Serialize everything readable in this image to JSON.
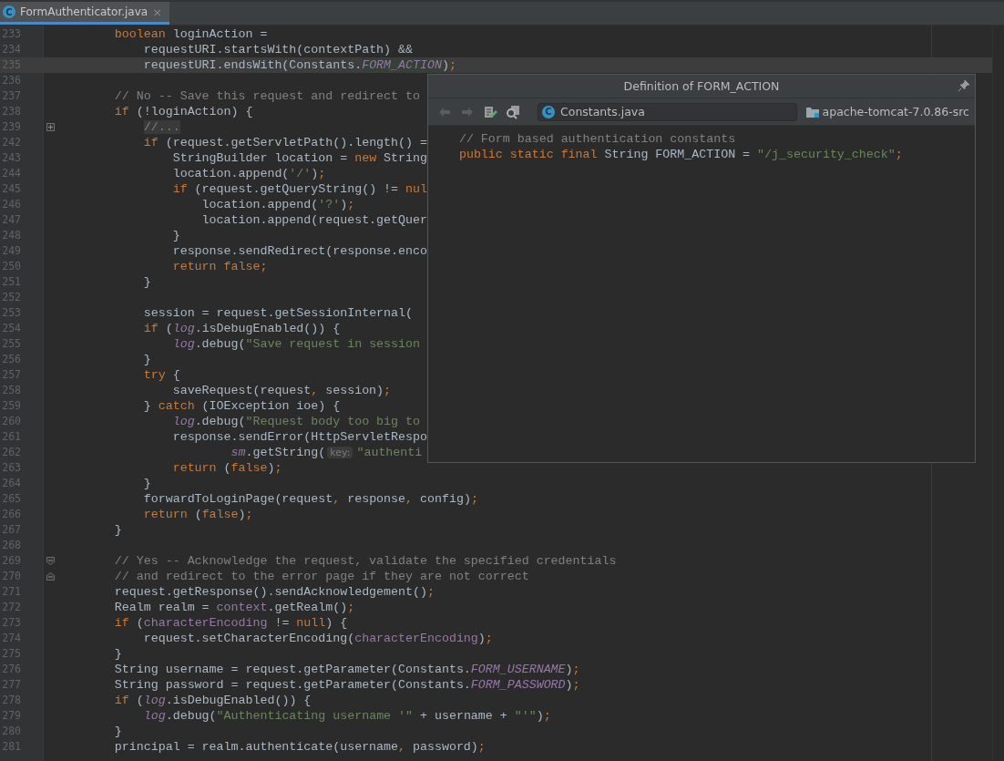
{
  "tabs": [
    {
      "label": "FormAuthenticator.java",
      "icon": "C",
      "selected": true,
      "close": "×"
    }
  ],
  "editor": {
    "lines": [
      {
        "number": "233",
        "kind": "code",
        "current": false,
        "tokens": [
          {
            "text": "        boolean",
            "kind": "kw"
          },
          {
            "text": " loginAction =",
            "kind": "plain"
          }
        ]
      },
      {
        "number": "234",
        "kind": "code",
        "current": false,
        "tokens": [
          {
            "text": "            requestURI.startsWith(contextPath) &&",
            "kind": "plain"
          }
        ]
      },
      {
        "number": "235",
        "kind": "code",
        "current": true,
        "tokens": [
          {
            "text": "            requestURI.endsWith(Constants.",
            "kind": "plain"
          },
          {
            "text": "FORM_ACTION",
            "kind": "match"
          },
          {
            "text": ")",
            "kind": "plain"
          },
          {
            "text": ";",
            "kind": "punct"
          }
        ]
      },
      {
        "number": "236",
        "kind": "code",
        "current": false
      },
      {
        "number": "237",
        "kind": "code",
        "current": false,
        "tokens": [
          {
            "text": "        // No -- Save this request and redirect to",
            "kind": "com"
          }
        ]
      },
      {
        "number": "238",
        "kind": "code",
        "current": false,
        "tokens": [
          {
            "text": "        if",
            "kind": "kw"
          },
          {
            "text": " (!loginAction) {",
            "kind": "plain"
          }
        ]
      },
      {
        "number": "239",
        "kind": "foldexpand",
        "current": false,
        "tokens": [
          {
            "text": "            //...",
            "kind": "fold"
          }
        ]
      },
      {
        "number": "242",
        "kind": "code",
        "current": false,
        "tokens": [
          {
            "text": "            if",
            "kind": "kw"
          },
          {
            "text": " (request.getServletPath().length() =",
            "kind": "plain"
          }
        ]
      },
      {
        "number": "243",
        "kind": "code",
        "current": false,
        "tokens": [
          {
            "text": "                StringBuilder location = ",
            "kind": "plain"
          },
          {
            "text": "new",
            "kind": "kw"
          },
          {
            "text": " String",
            "kind": "plain"
          }
        ]
      },
      {
        "number": "244",
        "kind": "code",
        "current": false,
        "tokens": [
          {
            "text": "                location.append(",
            "kind": "plain"
          },
          {
            "text": "'/'",
            "kind": "str"
          },
          {
            "text": ")",
            "kind": "plain"
          },
          {
            "text": ";",
            "kind": "punct"
          }
        ]
      },
      {
        "number": "245",
        "kind": "code",
        "current": false,
        "tokens": [
          {
            "text": "                if",
            "kind": "kw"
          },
          {
            "text": " (request.getQueryString() != ",
            "kind": "plain"
          },
          {
            "text": "nul",
            "kind": "kw"
          }
        ]
      },
      {
        "number": "246",
        "kind": "code",
        "current": false,
        "tokens": [
          {
            "text": "                    location.append(",
            "kind": "plain"
          },
          {
            "text": "'?'",
            "kind": "str"
          },
          {
            "text": ")",
            "kind": "plain"
          },
          {
            "text": ";",
            "kind": "punct"
          }
        ]
      },
      {
        "number": "247",
        "kind": "code",
        "current": false,
        "tokens": [
          {
            "text": "                    location.append(request.getQuer",
            "kind": "plain"
          }
        ]
      },
      {
        "number": "248",
        "kind": "code",
        "current": false,
        "tokens": [
          {
            "text": "                }",
            "kind": "plain"
          }
        ]
      },
      {
        "number": "249",
        "kind": "code",
        "current": false,
        "tokens": [
          {
            "text": "                response.sendRedirect(response.enco",
            "kind": "plain"
          }
        ]
      },
      {
        "number": "250",
        "kind": "code",
        "current": false,
        "tokens": [
          {
            "text": "                return false",
            "kind": "kw"
          },
          {
            "text": ";",
            "kind": "punct"
          }
        ]
      },
      {
        "number": "251",
        "kind": "code",
        "current": false,
        "tokens": [
          {
            "text": "            }",
            "kind": "plain"
          }
        ]
      },
      {
        "number": "252",
        "kind": "code",
        "current": false
      },
      {
        "number": "253",
        "kind": "code",
        "current": false,
        "tokens": [
          {
            "text": "            session = request.getSessionInternal(",
            "kind": "plain"
          }
        ]
      },
      {
        "number": "254",
        "kind": "code",
        "current": false,
        "tokens": [
          {
            "text": "            if",
            "kind": "kw"
          },
          {
            "text": " (",
            "kind": "plain"
          },
          {
            "text": "log",
            "kind": "ifield"
          },
          {
            "text": ".isDebugEnabled()) {",
            "kind": "plain"
          }
        ]
      },
      {
        "number": "255",
        "kind": "code",
        "current": false,
        "tokens": [
          {
            "text": "                log",
            "kind": "ifield"
          },
          {
            "text": ".debug(",
            "kind": "plain"
          },
          {
            "text": "\"Save request in session",
            "kind": "str"
          }
        ]
      },
      {
        "number": "256",
        "kind": "code",
        "current": false,
        "tokens": [
          {
            "text": "            }",
            "kind": "plain"
          }
        ]
      },
      {
        "number": "257",
        "kind": "code",
        "current": false,
        "tokens": [
          {
            "text": "            try",
            "kind": "kw"
          },
          {
            "text": " {",
            "kind": "plain"
          }
        ]
      },
      {
        "number": "258",
        "kind": "code",
        "current": false,
        "tokens": [
          {
            "text": "                saveRequest(request",
            "kind": "plain"
          },
          {
            "text": ",",
            "kind": "punct"
          },
          {
            "text": " session)",
            "kind": "plain"
          },
          {
            "text": ";",
            "kind": "punct"
          }
        ]
      },
      {
        "number": "259",
        "kind": "code",
        "current": false,
        "tokens": [
          {
            "text": "            } ",
            "kind": "plain"
          },
          {
            "text": "catch",
            "kind": "kw"
          },
          {
            "text": " (IOException ioe) {",
            "kind": "plain"
          }
        ]
      },
      {
        "number": "260",
        "kind": "code",
        "current": false,
        "tokens": [
          {
            "text": "                log",
            "kind": "ifield"
          },
          {
            "text": ".debug(",
            "kind": "plain"
          },
          {
            "text": "\"Request body too big to",
            "kind": "str"
          }
        ]
      },
      {
        "number": "261",
        "kind": "code",
        "current": false,
        "tokens": [
          {
            "text": "                response.sendError(HttpServletRespo",
            "kind": "plain"
          }
        ]
      },
      {
        "number": "262",
        "kind": "code",
        "current": false,
        "tokens": [
          {
            "text": "                        sm",
            "kind": "ifield"
          },
          {
            "text": ".getString(",
            "kind": "plain"
          },
          {
            "text": "key:",
            "kind": "hint"
          },
          {
            "text": "\"authenti",
            "kind": "str"
          }
        ]
      },
      {
        "number": "263",
        "kind": "code",
        "current": false,
        "tokens": [
          {
            "text": "                return",
            "kind": "kw"
          },
          {
            "text": " (",
            "kind": "plain"
          },
          {
            "text": "false",
            "kind": "kw"
          },
          {
            "text": ")",
            "kind": "plain"
          },
          {
            "text": ";",
            "kind": "punct"
          }
        ]
      },
      {
        "number": "264",
        "kind": "code",
        "current": false,
        "tokens": [
          {
            "text": "            }",
            "kind": "plain"
          }
        ]
      },
      {
        "number": "265",
        "kind": "code",
        "current": false,
        "tokens": [
          {
            "text": "            forwardToLoginPage(request",
            "kind": "plain"
          },
          {
            "text": ",",
            "kind": "punct"
          },
          {
            "text": " response",
            "kind": "plain"
          },
          {
            "text": ",",
            "kind": "punct"
          },
          {
            "text": " config)",
            "kind": "plain"
          },
          {
            "text": ";",
            "kind": "punct"
          }
        ]
      },
      {
        "number": "266",
        "kind": "code",
        "current": false,
        "tokens": [
          {
            "text": "            return",
            "kind": "kw"
          },
          {
            "text": " (",
            "kind": "plain"
          },
          {
            "text": "false",
            "kind": "kw"
          },
          {
            "text": ")",
            "kind": "plain"
          },
          {
            "text": ";",
            "kind": "punct"
          }
        ]
      },
      {
        "number": "267",
        "kind": "code",
        "current": false,
        "tokens": [
          {
            "text": "        }",
            "kind": "plain"
          }
        ]
      },
      {
        "number": "268",
        "kind": "code",
        "current": false
      },
      {
        "number": "269",
        "kind": "foldstart",
        "current": false,
        "tokens": [
          {
            "text": "        // Yes -- Acknowledge the request, validate the specified credentials",
            "kind": "com"
          }
        ]
      },
      {
        "number": "270",
        "kind": "foldend",
        "current": false,
        "tokens": [
          {
            "text": "        // and redirect to the error page if they are not correct",
            "kind": "com"
          }
        ]
      },
      {
        "number": "271",
        "kind": "code",
        "current": false,
        "tokens": [
          {
            "text": "        request.getResponse().sendAcknowledgement()",
            "kind": "plain"
          },
          {
            "text": ";",
            "kind": "punct"
          }
        ]
      },
      {
        "number": "272",
        "kind": "code",
        "current": false,
        "tokens": [
          {
            "text": "        Realm realm = ",
            "kind": "plain"
          },
          {
            "text": "context",
            "kind": "field"
          },
          {
            "text": ".getRealm()",
            "kind": "plain"
          },
          {
            "text": ";",
            "kind": "punct"
          }
        ]
      },
      {
        "number": "273",
        "kind": "code",
        "current": false,
        "tokens": [
          {
            "text": "        if",
            "kind": "kw"
          },
          {
            "text": " (",
            "kind": "plain"
          },
          {
            "text": "characterEncoding",
            "kind": "field"
          },
          {
            "text": " != ",
            "kind": "plain"
          },
          {
            "text": "null",
            "kind": "kw"
          },
          {
            "text": ") {",
            "kind": "plain"
          }
        ]
      },
      {
        "number": "274",
        "kind": "code",
        "current": false,
        "tokens": [
          {
            "text": "            request.setCharacterEncoding(",
            "kind": "plain"
          },
          {
            "text": "characterEncoding",
            "kind": "field"
          },
          {
            "text": ")",
            "kind": "plain"
          },
          {
            "text": ";",
            "kind": "punct"
          }
        ]
      },
      {
        "number": "275",
        "kind": "code",
        "current": false,
        "tokens": [
          {
            "text": "        }",
            "kind": "plain"
          }
        ]
      },
      {
        "number": "276",
        "kind": "code",
        "current": false,
        "tokens": [
          {
            "text": "        String username = request.getParameter(Constants.",
            "kind": "plain"
          },
          {
            "text": "FORM_USERNAME",
            "kind": "ifield"
          },
          {
            "text": ")",
            "kind": "plain"
          },
          {
            "text": ";",
            "kind": "punct"
          }
        ]
      },
      {
        "number": "277",
        "kind": "code",
        "current": false,
        "tokens": [
          {
            "text": "        String password = request.getParameter(Constants.",
            "kind": "plain"
          },
          {
            "text": "FORM_PASSWORD",
            "kind": "ifield"
          },
          {
            "text": ")",
            "kind": "plain"
          },
          {
            "text": ";",
            "kind": "punct"
          }
        ]
      },
      {
        "number": "278",
        "kind": "code",
        "current": false,
        "tokens": [
          {
            "text": "        if",
            "kind": "kw"
          },
          {
            "text": " (",
            "kind": "plain"
          },
          {
            "text": "log",
            "kind": "ifield"
          },
          {
            "text": ".isDebugEnabled()) {",
            "kind": "plain"
          }
        ]
      },
      {
        "number": "279",
        "kind": "code",
        "current": false,
        "tokens": [
          {
            "text": "            log",
            "kind": "ifield"
          },
          {
            "text": ".debug(",
            "kind": "plain"
          },
          {
            "text": "\"Authenticating username '\"",
            "kind": "str"
          },
          {
            "text": " + username + ",
            "kind": "plain"
          },
          {
            "text": "\"'\"",
            "kind": "str"
          },
          {
            "text": ")",
            "kind": "plain"
          },
          {
            "text": ";",
            "kind": "punct"
          }
        ]
      },
      {
        "number": "280",
        "kind": "code",
        "current": false,
        "tokens": [
          {
            "text": "        }",
            "kind": "plain"
          }
        ]
      },
      {
        "number": "281",
        "kind": "code",
        "current": false,
        "tokens": [
          {
            "text": "        principal = realm.authenticate(username",
            "kind": "plain"
          },
          {
            "text": ",",
            "kind": "punct"
          },
          {
            "text": " password)",
            "kind": "plain"
          },
          {
            "text": ";",
            "kind": "punct"
          }
        ]
      }
    ]
  },
  "popup": {
    "title": "Definition of FORM_ACTION",
    "file": {
      "icon": "C",
      "name": "Constants.java"
    },
    "project": "apache-tomcat-7.0.86-src",
    "lines": [
      {
        "tokens": [
          {
            "text": "    // Form based authentication constants",
            "kind": "com"
          }
        ]
      },
      {
        "tokens": [
          {
            "text": "    public static final",
            "kind": "kw"
          },
          {
            "text": " String FORM_ACTION = ",
            "kind": "plain"
          },
          {
            "text": "\"/j_security_check\"",
            "kind": "str"
          },
          {
            "text": ";",
            "kind": "punct"
          }
        ]
      }
    ]
  }
}
